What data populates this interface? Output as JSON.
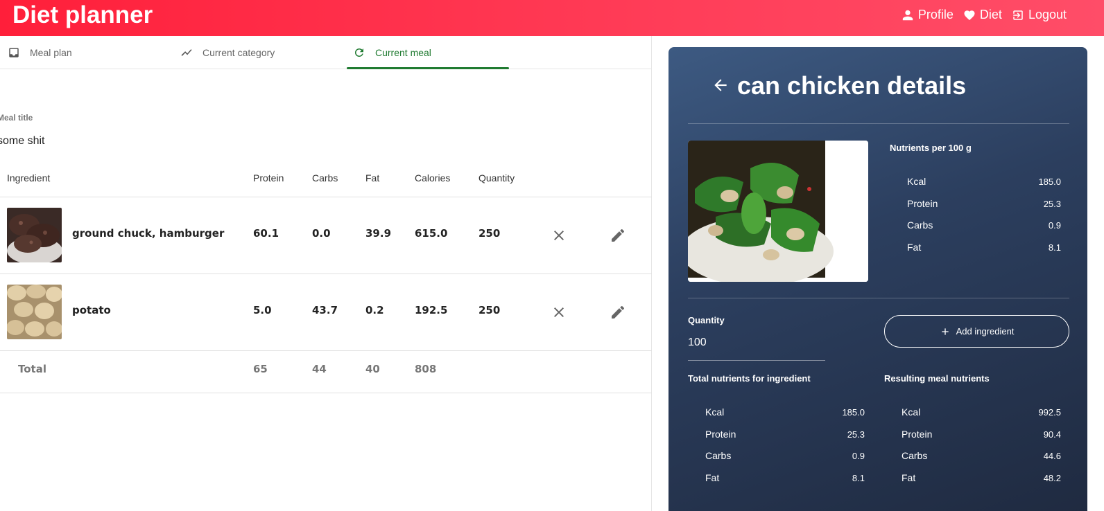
{
  "app": {
    "title": "Diet planner"
  },
  "header_nav": [
    {
      "label": "Profile",
      "icon": "person-icon"
    },
    {
      "label": "Diet",
      "icon": "heart-icon"
    },
    {
      "label": "Logout",
      "icon": "logout-icon"
    }
  ],
  "tabs": [
    {
      "label": "Meal plan",
      "icon": "inbox-icon",
      "active": false
    },
    {
      "label": "Current category",
      "icon": "trending-icon",
      "active": false
    },
    {
      "label": "Current meal",
      "icon": "refresh-icon",
      "active": true
    }
  ],
  "meal": {
    "title_label": "Meal title",
    "title_value": "some shit"
  },
  "table": {
    "headers": [
      "Ingredient",
      "Protein",
      "Carbs",
      "Fat",
      "Calories",
      "Quantity"
    ],
    "rows": [
      {
        "name": "ground chuck, hamburger",
        "protein": "60.1",
        "carbs": "0.0",
        "fat": "39.9",
        "calories": "615.0",
        "quantity": "250"
      },
      {
        "name": "potato",
        "protein": "5.0",
        "carbs": "43.7",
        "fat": "0.2",
        "calories": "192.5",
        "quantity": "250"
      }
    ],
    "total": {
      "label": "Total",
      "protein": "65",
      "carbs": "44",
      "fat": "40",
      "calories": "808"
    }
  },
  "details": {
    "title": "can chicken details",
    "per100_label": "Nutrients per 100 g",
    "per100": [
      {
        "label": "Kcal",
        "value": "185.0"
      },
      {
        "label": "Protein",
        "value": "25.3"
      },
      {
        "label": "Carbs",
        "value": "0.9"
      },
      {
        "label": "Fat",
        "value": "8.1"
      }
    ],
    "quantity_label": "Quantity",
    "quantity_value": "100",
    "add_button": "Add ingredient",
    "total_label": "Total nutrients for ingredient",
    "total": [
      {
        "label": "Kcal",
        "value": "185.0"
      },
      {
        "label": "Protein",
        "value": "25.3"
      },
      {
        "label": "Carbs",
        "value": "0.9"
      },
      {
        "label": "Fat",
        "value": "8.1"
      }
    ],
    "resulting_label": "Resulting meal nutrients",
    "resulting": [
      {
        "label": "Kcal",
        "value": "992.5"
      },
      {
        "label": "Protein",
        "value": "90.4"
      },
      {
        "label": "Carbs",
        "value": "44.6"
      },
      {
        "label": "Fat",
        "value": "48.2"
      }
    ]
  },
  "colors": {
    "header_start": "#ff1f3a",
    "header_end": "#ff4d68",
    "accent_green": "#1f7a30",
    "panel_dark": "#2c3f5f"
  }
}
